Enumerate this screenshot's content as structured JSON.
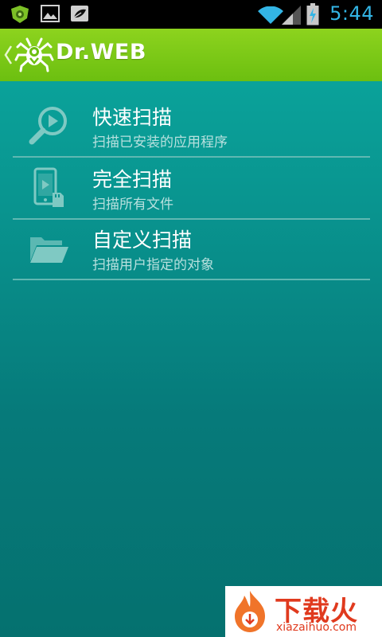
{
  "status_bar": {
    "time": "5:44",
    "icons": [
      "drweb-shield-icon",
      "picture-icon",
      "leaf-icon",
      "wifi-icon",
      "signal-icon",
      "battery-charging-icon"
    ]
  },
  "action_bar": {
    "title": "Dr.WEB",
    "back_icon": "chevron-left-icon",
    "logo_icon": "drweb-spider-logo"
  },
  "menu": {
    "items": [
      {
        "title": "快速扫描",
        "subtitle": "扫描已安装的应用程序",
        "icon": "magnifier-play-icon"
      },
      {
        "title": "完全扫描",
        "subtitle": "扫描所有文件",
        "icon": "phone-sdcard-icon"
      },
      {
        "title": "自定义扫描",
        "subtitle": "扫描用户指定的对象",
        "icon": "folder-open-icon"
      }
    ]
  },
  "watermark": {
    "name": "下载火",
    "url": "xiazaihuo.com"
  },
  "colors": {
    "action_bar_green": "#7ac816",
    "content_teal": "#09948f",
    "time_blue": "#33b5e5",
    "icon_tint": "#7fc9c3",
    "watermark_red": "#e03a1e"
  }
}
